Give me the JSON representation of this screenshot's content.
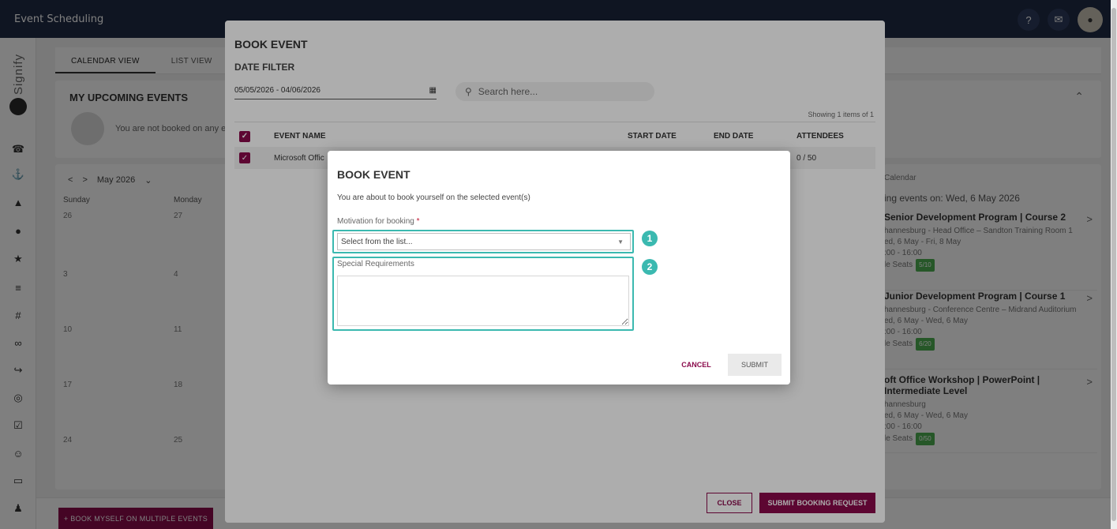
{
  "app": {
    "title": "Event Scheduling",
    "help_icon": "help-icon",
    "notification_icon": "notification-icon",
    "avatar_icon": "user-avatar"
  },
  "sidebar": {
    "logo_text": "Signify",
    "icons": [
      "megaphone-icon",
      "anchor-icon",
      "graduation-icon",
      "compass-icon",
      "star-icon",
      "sliders-icon",
      "grid-icon",
      "infinity-icon",
      "share-icon",
      "globe-icon",
      "checkbox-icon",
      "person-icon",
      "laptop-icon",
      "user-add-icon"
    ]
  },
  "tabs": [
    {
      "label": "CALENDAR VIEW",
      "active": true
    },
    {
      "label": "LIST VIEW",
      "active": false
    }
  ],
  "upcoming": {
    "title": "MY UPCOMING EVENTS",
    "empty_text": "You are not booked on any events"
  },
  "calendar": {
    "month": "May 2026",
    "days": [
      "Sunday",
      "Monday"
    ],
    "weeks": [
      [
        "26",
        "27"
      ],
      [
        "3",
        "4"
      ],
      [
        "10",
        "11"
      ],
      [
        "17",
        "18"
      ],
      [
        "24",
        "25"
      ]
    ]
  },
  "side_panel": {
    "calendar_label": "Calendar",
    "events_on": "ing events on: Wed, 6 May 2026",
    "events": [
      {
        "title": "Senior Development Program | Course 2",
        "location": "hannesburg - Head Office – Sandton Training Room 1",
        "dates": "ed, 6 May - Fri, 8 May",
        "time": ":00 - 16:00",
        "seats_label": "le Seats",
        "seats": "5/10"
      },
      {
        "title": "Junior Development Program | Course 1",
        "location": "hannesburg - Conference Centre – Midrand Auditorium",
        "dates": "ed, 6 May - Wed, 6 May",
        "time": ":00 - 16:00",
        "seats_label": "le Seats",
        "seats": "6/20"
      },
      {
        "title": "oft Office Workshop | PowerPoint | Intermediate Level",
        "location": "hannesburg",
        "dates": "ed, 6 May - Wed, 6 May",
        "time": ":00 - 16:00",
        "seats_label": "le Seats",
        "seats": "0/50"
      }
    ]
  },
  "bottom": {
    "bulk_button": "+ BOOK MYSELF ON MULTIPLE EVENTS"
  },
  "modal1": {
    "title": "BOOK EVENT",
    "filter_label": "DATE FILTER",
    "date_range": "05/05/2026 - 04/06/2026",
    "search_placeholder": "Search here...",
    "showing": "Showing 1 items of 1",
    "columns": {
      "name": "EVENT NAME",
      "start": "START DATE",
      "end": "END DATE",
      "attendees": "ATTENDEES"
    },
    "row": {
      "name": "Microsoft Offic",
      "attendees": "0 / 50"
    },
    "close_button": "CLOSE",
    "submit_button": "SUBMIT BOOKING REQUEST"
  },
  "modal2": {
    "title": "BOOK EVENT",
    "description": "You are about to book yourself on the selected event(s)",
    "motivation_label": "Motivation for booking",
    "required_marker": "*",
    "select_value": "Select from the list...",
    "special_label": "Special Requirements",
    "textarea_value": "",
    "cancel_button": "CANCEL",
    "submit_button": "SUBMIT",
    "badges": [
      "1",
      "2"
    ]
  },
  "colors": {
    "brand": "#8a0a4b",
    "highlight": "#3bb9b0",
    "topbar": "#1f2a44"
  }
}
